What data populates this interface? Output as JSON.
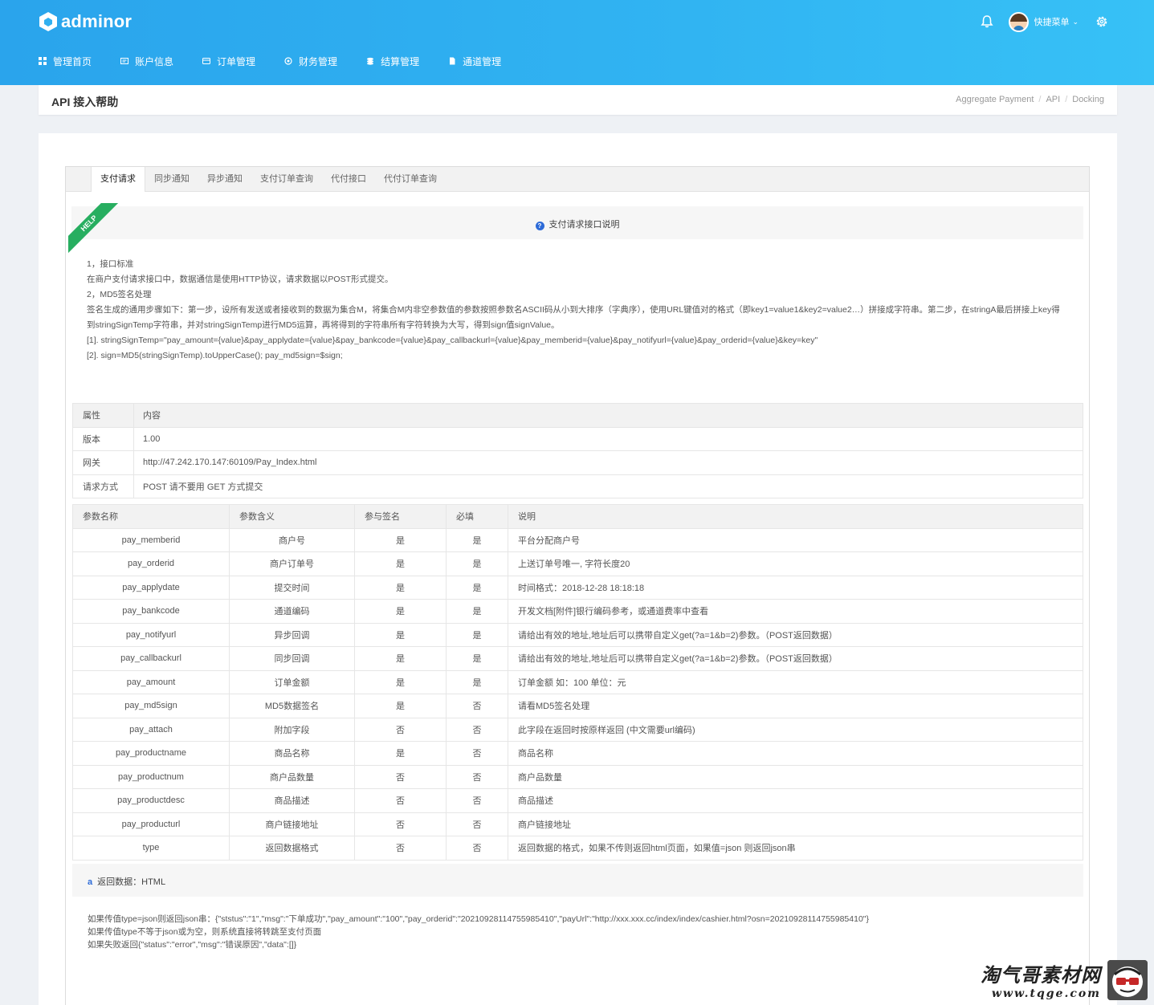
{
  "brand": {
    "name": "adminor"
  },
  "header": {
    "user_label": "快捷菜单",
    "caret": "⌄"
  },
  "nav": [
    {
      "label": "管理首页",
      "icon": "dashboard-icon"
    },
    {
      "label": "账户信息",
      "icon": "account-icon"
    },
    {
      "label": "订单管理",
      "icon": "order-icon"
    },
    {
      "label": "财务管理",
      "icon": "finance-icon"
    },
    {
      "label": "结算管理",
      "icon": "settlement-icon"
    },
    {
      "label": "通道管理",
      "icon": "channel-icon"
    }
  ],
  "page": {
    "title": "API 接入帮助",
    "breadcrumb": [
      "Aggregate Payment",
      "API",
      "Docking"
    ],
    "breadcrumb_sep": "/"
  },
  "tabs": [
    "支付请求",
    "同步通知",
    "异步通知",
    "支付订单查询",
    "代付接口",
    "代付订单查询"
  ],
  "help": {
    "ribbon": "HELP",
    "title": "支付请求接口说明",
    "lines": [
      "1，接口标准",
      "在商户支付请求接口中，数据通信是使用HTTP协议，请求数据以POST形式提交。",
      "2，MD5签名处理",
      "签名生成的通用步骤如下：第一步，设所有发送或者接收到的数据为集合M，将集合M内非空参数值的参数按照参数名ASCII码从小到大排序（字典序），使用URL键值对的格式（即key1=value1&key2=value2…）拼接成字符串。第二步，在stringA最后拼接上key得到stringSignTemp字符串，并对stringSignTemp进行MD5运算，再将得到的字符串所有字符转换为大写，得到sign值signValue。",
      "[1]. stringSignTemp=\"pay_amount={value}&pay_applydate={value}&pay_bankcode={value}&pay_callbackurl={value}&pay_memberid={value}&pay_notifyurl={value}&pay_orderid={value}&key=key\"",
      "[2]. sign=MD5(stringSignTemp).toUpperCase(); pay_md5sign=$sign;"
    ]
  },
  "info_table": {
    "headers": [
      "属性",
      "内容"
    ],
    "rows": [
      [
        "版本",
        "1.00"
      ],
      [
        "网关",
        "http://47.242.170.147:60109/Pay_Index.html"
      ],
      [
        "请求方式",
        "POST 请不要用 GET 方式提交"
      ]
    ]
  },
  "params_table": {
    "headers": [
      "参数名称",
      "参数含义",
      "参与签名",
      "必填",
      "说明"
    ],
    "rows": [
      [
        "pay_memberid",
        "商户号",
        "是",
        "是",
        "平台分配商户号"
      ],
      [
        "pay_orderid",
        "商户订单号",
        "是",
        "是",
        "上送订单号唯一, 字符长度20"
      ],
      [
        "pay_applydate",
        "提交时间",
        "是",
        "是",
        "时间格式：2018-12-28 18:18:18"
      ],
      [
        "pay_bankcode",
        "通道编码",
        "是",
        "是",
        "开发文档[附件]银行编码参考，或通道费率中查看"
      ],
      [
        "pay_notifyurl",
        "异步回调",
        "是",
        "是",
        "请给出有效的地址,地址后可以携带自定义get(?a=1&b=2)参数。（POST返回数据）"
      ],
      [
        "pay_callbackurl",
        "同步回调",
        "是",
        "是",
        "请给出有效的地址,地址后可以携带自定义get(?a=1&b=2)参数。（POST返回数据）"
      ],
      [
        "pay_amount",
        "订单金额",
        "是",
        "是",
        "订单金额 如：100 单位：元"
      ],
      [
        "pay_md5sign",
        "MD5数据签名",
        "是",
        "否",
        "请看MD5签名处理"
      ],
      [
        "pay_attach",
        "附加字段",
        "否",
        "否",
        "此字段在返回时按原样返回 (中文需要url编码)"
      ],
      [
        "pay_productname",
        "商品名称",
        "是",
        "否",
        "商品名称"
      ],
      [
        "pay_productnum",
        "商户品数量",
        "否",
        "否",
        "商户品数量"
      ],
      [
        "pay_productdesc",
        "商品描述",
        "否",
        "否",
        "商品描述"
      ],
      [
        "pay_producturl",
        "商户链接地址",
        "否",
        "否",
        "商户链接地址"
      ],
      [
        "type",
        "返回数据格式",
        "否",
        "否",
        "返回数据的格式，如果不传则返回html页面，如果值=json 则返回json串"
      ]
    ]
  },
  "return_block": {
    "icon_letter": "a",
    "title": "返回数据：HTML",
    "lines": [
      "如果传值type=json则返回json串：{\"ststus\":\"1\",\"msg\":\"下单成功\",\"pay_amount\":\"100\",\"pay_orderid\":\"20210928114755985410\",\"payUrl\":\"http://xxx.xxx.cc/index/index/cashier.html?osn=20210928114755985410\"}",
      "如果传值type不等于json或为空，则系统直接将转跳至支付页面",
      "如果失败返回{\"status\":\"error\",\"msg\":\"错误原因\",\"data\":[]}"
    ]
  },
  "watermark": {
    "cn": "淘气哥素材网",
    "en": "www.tqge.com"
  },
  "colors": {
    "header_start": "#2aa4ec",
    "header_end": "#37c1f6",
    "ribbon": "#27ae60",
    "info_icon": "#2d6bd8"
  }
}
